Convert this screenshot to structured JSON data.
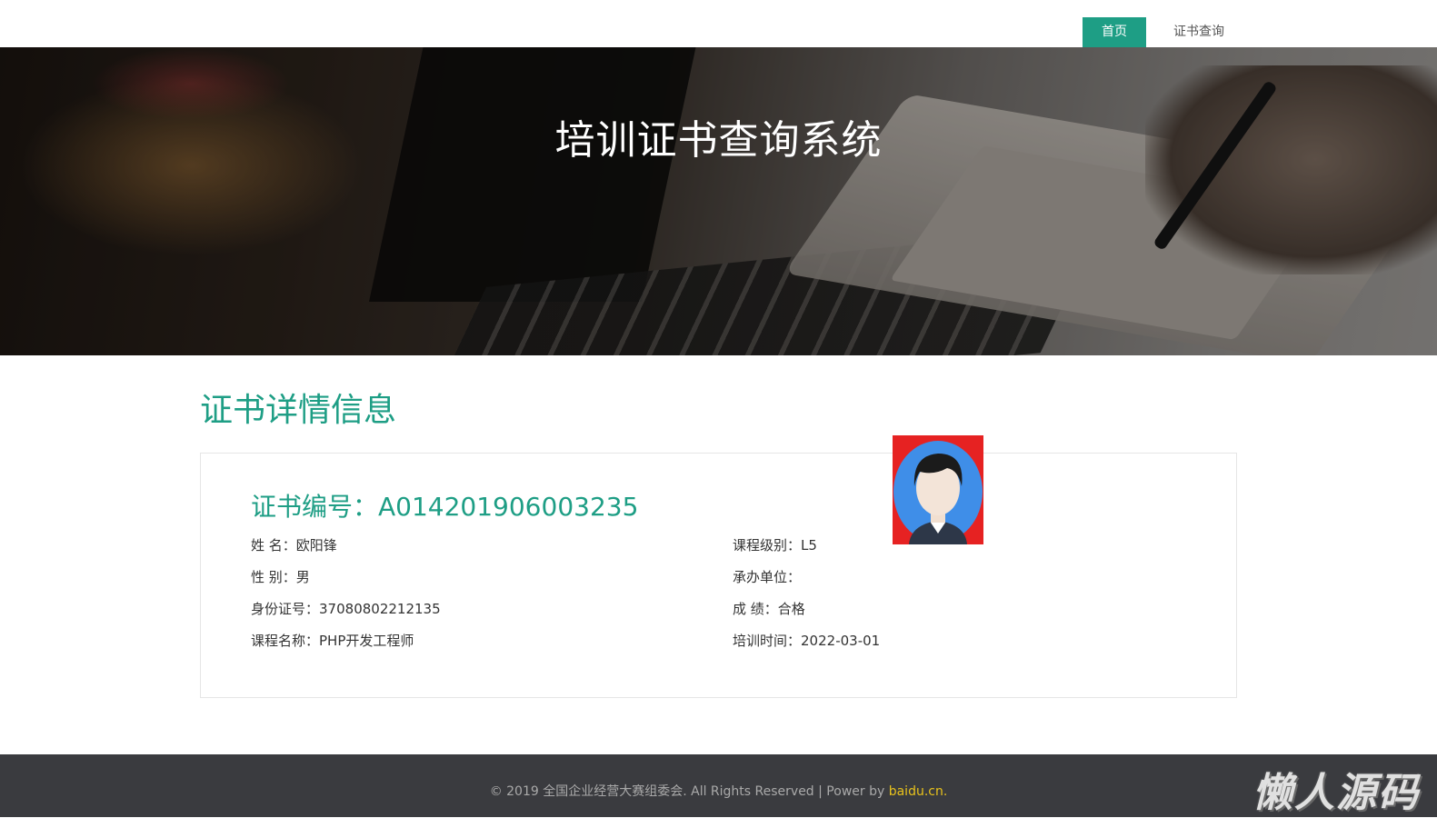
{
  "nav": {
    "items": [
      {
        "label": "首页",
        "active": true
      },
      {
        "label": "证书查询",
        "active": false
      }
    ]
  },
  "banner": {
    "title": "培训证书查询系统"
  },
  "section": {
    "title": "证书详情信息"
  },
  "certificate": {
    "number_label": "证书编号：",
    "number_value": "A014201906003235",
    "left_fields": [
      {
        "label": "姓 名：",
        "value": "欧阳锋"
      },
      {
        "label": "性 别：",
        "value": "男"
      },
      {
        "label": "身份证号：",
        "value": "37080802212135"
      },
      {
        "label": "课程名称：",
        "value": "PHP开发工程师"
      }
    ],
    "right_fields": [
      {
        "label": "课程级别：",
        "value": "L5"
      },
      {
        "label": "承办单位：",
        "value": ""
      },
      {
        "label": "成 绩：",
        "value": "合格"
      },
      {
        "label": "培训时间：",
        "value": "2022-03-01"
      }
    ],
    "photo_icon": "user-avatar-icon"
  },
  "footer": {
    "text": "© 2019 全国企业经营大赛组委会. All Rights Reserved | Power by ",
    "link": "baidu.cn."
  },
  "watermark": "懒人源码",
  "colors": {
    "accent": "#1e9e85",
    "footer_bg": "#3a3b3f",
    "footer_link": "#e8c21c",
    "photo_bg": "#e62222"
  }
}
